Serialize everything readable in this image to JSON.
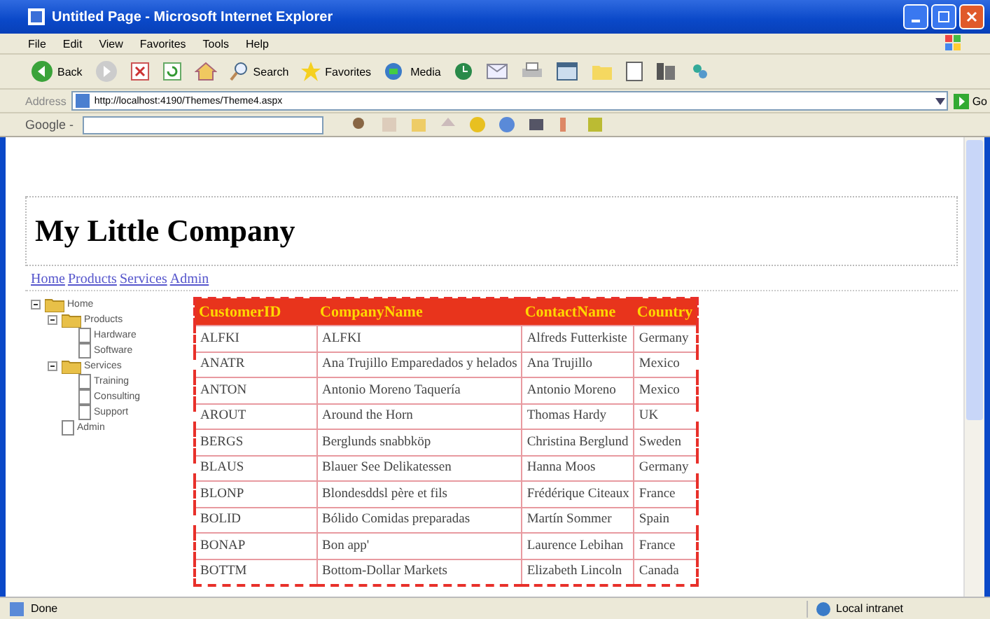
{
  "window": {
    "title": "Untitled Page - Microsoft Internet Explorer"
  },
  "menu": [
    "File",
    "Edit",
    "View",
    "Favorites",
    "Tools",
    "Help"
  ],
  "toolbar": {
    "back": "Back",
    "search": "Search",
    "favorites": "Favorites",
    "media": "Media"
  },
  "address": {
    "label": "Address",
    "url": "http://localhost:4190/Themes/Theme4.aspx",
    "go": "Go"
  },
  "google_bar": {
    "label": "Google -"
  },
  "page": {
    "heading": "My Little Company",
    "links": [
      "Home",
      "Products",
      "Services",
      "Admin"
    ],
    "tree": [
      {
        "label": "Home",
        "expanded": true,
        "children": [
          {
            "label": "Products",
            "expanded": true,
            "children": [
              {
                "label": "Hardware"
              },
              {
                "label": "Software"
              }
            ]
          },
          {
            "label": "Services",
            "expanded": true,
            "children": [
              {
                "label": "Training"
              },
              {
                "label": "Consulting"
              },
              {
                "label": "Support"
              }
            ]
          },
          {
            "label": "Admin"
          }
        ]
      }
    ],
    "table": {
      "columns": [
        "CustomerID",
        "CompanyName",
        "ContactName",
        "Country"
      ],
      "rows": [
        [
          "ALFKI",
          "ALFKI",
          "Alfreds Futterkiste",
          "Germany"
        ],
        [
          "ANATR",
          "Ana Trujillo Emparedados y helados",
          "Ana Trujillo",
          "Mexico"
        ],
        [
          "ANTON",
          "Antonio Moreno Taquería",
          "Antonio Moreno",
          "Mexico"
        ],
        [
          "AROUT",
          "Around the Horn",
          "Thomas Hardy",
          "UK"
        ],
        [
          "BERGS",
          "Berglunds snabbköp",
          "Christina Berglund",
          "Sweden"
        ],
        [
          "BLAUS",
          "Blauer See Delikatessen",
          "Hanna Moos",
          "Germany"
        ],
        [
          "BLONP",
          "Blondesddsl père et fils",
          "Frédérique Citeaux",
          "France"
        ],
        [
          "BOLID",
          "Bólido Comidas preparadas",
          "Martín Sommer",
          "Spain"
        ],
        [
          "BONAP",
          "Bon app'",
          "Laurence Lebihan",
          "France"
        ],
        [
          "BOTTM",
          "Bottom-Dollar Markets",
          "Elizabeth Lincoln",
          "Canada"
        ]
      ]
    }
  },
  "status_bar": {
    "left": "Done",
    "zone": "Local intranet"
  }
}
